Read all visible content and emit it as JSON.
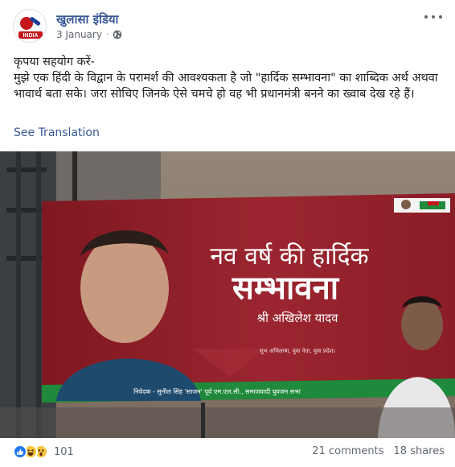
{
  "post": {
    "page_name": "खुलासा इंडिया",
    "date": "3 January",
    "privacy_icon": "globe-icon",
    "avatar_text": "INDIA",
    "body_lines": [
      "कृपया सहयोग करें-",
      "मुझे एक हिंदी के विद्वान के परामर्श की आवश्यकता है जो \"हार्दिक सम्भावना\" का शाब्दिक अर्थ अथवा भावार्थ बता सके। जरा सोचिए जिनके ऐसे चमचे हो वह भी प्रधानमंत्री बनने का ख्वाब देख रहे हैं।"
    ],
    "see_translation": "See Translation"
  },
  "photo": {
    "banner_title_line1": "नव वर्ष की हार्दिक",
    "banner_title_line2": "सम्भावना",
    "banner_name": "श्री अखिलेश यादव",
    "banner_small_text": "सुभ अभिलाषा, युवा नेता, युवा प्रदेश।",
    "banner_bottom_text": "निवेदक - सुनील सिंह 'साजन' पूर्व एम.एल.सी., समाजवादी युवजन सभा",
    "colors": {
      "banner_red": "#8c1d24",
      "banner_green": "#1f8a3c",
      "sky": "#8c7d72"
    }
  },
  "footer": {
    "reaction_icons": [
      "like-icon",
      "haha-icon",
      "wow-icon"
    ],
    "reaction_count": "101",
    "comments": "21 comments",
    "shares": "18 shares"
  }
}
